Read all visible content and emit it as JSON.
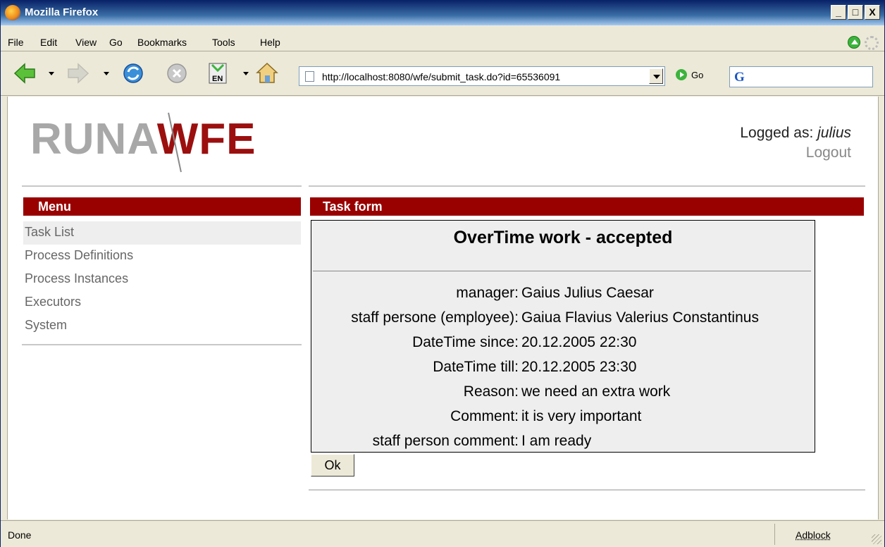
{
  "window": {
    "title": "Mozilla Firefox",
    "controls": [
      "_",
      "□",
      "X"
    ]
  },
  "menubar": {
    "items": [
      "File",
      "Edit",
      "View",
      "Go",
      "Bookmarks",
      "Tools",
      "Help"
    ]
  },
  "toolbar": {
    "url": "http://localhost:8080/wfe/submit_task.do?id=65536091",
    "go_label": "Go",
    "search_engine_letter": "G"
  },
  "page": {
    "logo_part1": "RUNA",
    "logo_part2": "WFE",
    "logged_as_label": "Logged as:",
    "username": "julius",
    "logout_label": "Logout",
    "menu_header": "Menu",
    "menu_items": [
      "Task List",
      "Process Definitions",
      "Process Instances",
      "Executors",
      "System"
    ],
    "task_header": "Task form",
    "form": {
      "title": "OverTime work - accepted",
      "fields": [
        {
          "label": "manager:",
          "value": "Gaius Julius Caesar"
        },
        {
          "label": "staff persone (employee):",
          "value": "Gaiua Flavius Valerius Constantinus"
        },
        {
          "label": "DateTime since:",
          "value": "20.12.2005 22:30"
        },
        {
          "label": "DateTime till:",
          "value": "20.12.2005 23:30"
        },
        {
          "label": "Reason:",
          "value": "we need an extra work"
        },
        {
          "label": "Comment:",
          "value": "it is very important"
        },
        {
          "label": "staff person comment:",
          "value": "I am ready"
        }
      ],
      "ok_label": "Ok"
    }
  },
  "statusbar": {
    "status": "Done",
    "adblock": "Adblock"
  },
  "colors": {
    "accent": "#990000",
    "logo_gray": "#a8a8a8",
    "menu_text": "#666666"
  }
}
